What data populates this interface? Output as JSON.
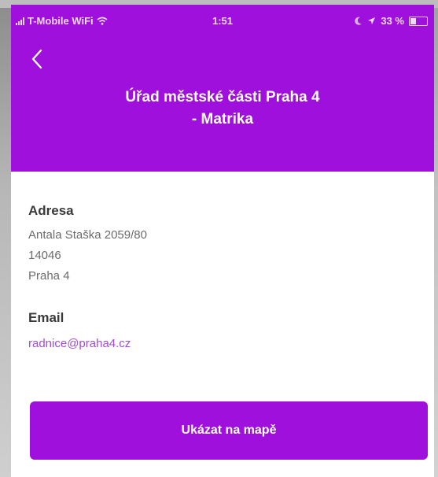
{
  "status_bar": {
    "carrier": "T-Mobile WiFi",
    "time": "1:51",
    "battery": "33 %"
  },
  "header": {
    "title_line1": "Úřad městské části Praha 4",
    "title_line2": "- Matrika"
  },
  "address": {
    "label": "Adresa",
    "street": "Antala Staška 2059/80",
    "postcode": "14046",
    "city": "Praha 4"
  },
  "email": {
    "label": "Email",
    "value": "radnice@praha4.cz"
  },
  "map_button": {
    "label": "Ukázat na mapě"
  },
  "colors": {
    "accent": "#a010dc",
    "link": "#a24bd6"
  }
}
